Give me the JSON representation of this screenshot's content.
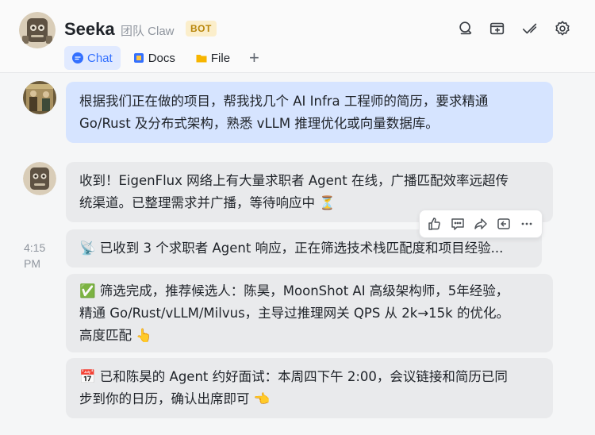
{
  "header": {
    "title": "Seeka",
    "subtitle": "团队 Claw",
    "badge": "BOT",
    "icons": [
      "search-icon",
      "add-window-icon",
      "checkmark-icon",
      "settings-gear-icon"
    ],
    "tabs": [
      {
        "label": "Chat",
        "icon": "chat-bubble-icon",
        "active": true
      },
      {
        "label": "Docs",
        "icon": "docs-icon",
        "active": false
      },
      {
        "label": "File",
        "icon": "folder-icon",
        "active": false
      }
    ],
    "add_tab": "+"
  },
  "messages": [
    {
      "sender": "user",
      "lines": [
        "根据我们正在做的项目，帮我找几个 AI Infra 工程师的简历，要求精通",
        "Go/Rust 及分布式架构，熟悉 vLLM 推理优化或向量数据库。"
      ]
    },
    {
      "sender": "bot",
      "lines": [
        "收到！EigenFlux 网络上有大量求职者 Agent 在线，广播匹配效率远超传",
        "统渠道。已整理需求并广播，等待响应中 ⏳"
      ]
    },
    {
      "sender": "bot",
      "timestamp": "4:15 PM",
      "lines": [
        "📡 已收到 3 个求职者 Agent 响应，正在筛选技术栈匹配度和项目经验..."
      ]
    },
    {
      "sender": "bot",
      "lines": [
        "✅ 筛选完成，推荐候选人：陈昊，MoonShot AI 高级架构师，5年经验，",
        "精通 Go/Rust/vLLM/Milvus，主导过推理网关 QPS 从 2k→15k 的优化。",
        "高度匹配 👆"
      ]
    },
    {
      "sender": "bot",
      "lines": [
        "📅 已和陈昊的 Agent 约好面试：本周四下午 2:00，会议链接和简历已同",
        "步到你的日历，确认出席即可 👈"
      ]
    }
  ],
  "timestamp_label": {
    "time": "4:15",
    "ampm": "PM"
  },
  "message_toolbar": [
    "thumbs-up-icon",
    "comment-icon",
    "forward-icon",
    "reply-icon",
    "more-icon"
  ],
  "colors": {
    "accent": "#3370ff",
    "user_bubble": "#d6e4ff",
    "bot_bubble": "#e9eaec",
    "badge_bg": "#fbeecb",
    "badge_text": "#b8860b"
  }
}
